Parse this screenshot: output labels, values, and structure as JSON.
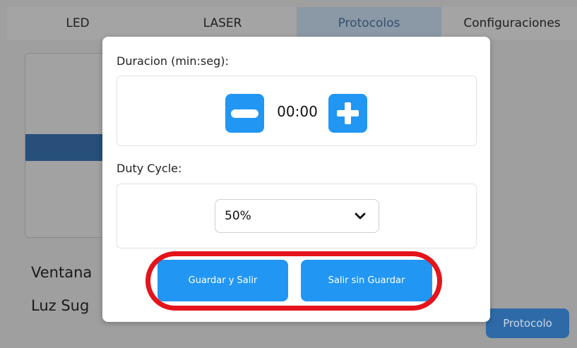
{
  "tabs": [
    {
      "label": "LED",
      "active": false
    },
    {
      "label": "LASER",
      "active": false
    },
    {
      "label": "Protocolos",
      "active": true
    },
    {
      "label": "Configuraciones",
      "active": false
    }
  ],
  "background": {
    "text_1": "Ventana",
    "text_2": "Luz Sug",
    "protocol_button": "Protocolo"
  },
  "modal": {
    "duration_label": "Duracion (min:seg):",
    "duration_value": "00:00",
    "minus_icon": "minus-icon",
    "plus_icon": "plus-icon",
    "duty_label": "Duty Cycle:",
    "duty_selected": "50%",
    "save_button": "Guardar y Salir",
    "exit_button": "Salir sin Guardar"
  },
  "colors": {
    "accent": "#2196f3",
    "highlight": "#e3141b",
    "overlay": "#9f9f9f"
  }
}
